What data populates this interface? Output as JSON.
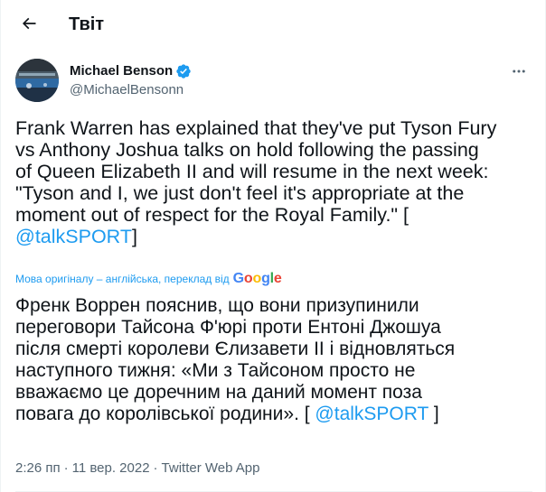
{
  "header": {
    "title": "Твіт",
    "back_icon": "arrow-left-icon"
  },
  "author": {
    "name": "Michael Benson",
    "handle": "@MichaelBensonn",
    "verified": true,
    "more_icon": "more-horizontal-icon"
  },
  "tweet": {
    "text_lines": [
      "Frank Warren has explained that they've put Tyson Fury",
      "vs Anthony Joshua talks on hold following the passing",
      "of Queen Elizabeth II and will resume in the next week:",
      "\"Tyson and I, we just don't feel it's appropriate at the",
      "moment out of respect for the Royal Family.\" ["
    ],
    "mention": "@talkSPORT",
    "mention_suffix": "]"
  },
  "translation": {
    "label": "Мова оригіналу – англійська, переклад від",
    "provider": "Google",
    "lines": [
      "Френк Воррен пояснив, що вони призупинили",
      "переговори Тайсона Ф'юрі проти Ентоні Джошуа",
      "після смерті королеви Єлизавети II і відновляться",
      "наступного тижня: «Ми з Тайсоном просто не",
      "вважаємо це доречним на даний момент поза",
      "повага до королівської родини». ["
    ],
    "mention": "@talkSPORT",
    "mention_suffix": " ]"
  },
  "meta": {
    "time": "2:26 пп",
    "date": "11 вер. 2022",
    "source": "Twitter Web App"
  },
  "colors": {
    "accent": "#1d9bf0",
    "secondary": "#536471",
    "text": "#0f1419"
  }
}
